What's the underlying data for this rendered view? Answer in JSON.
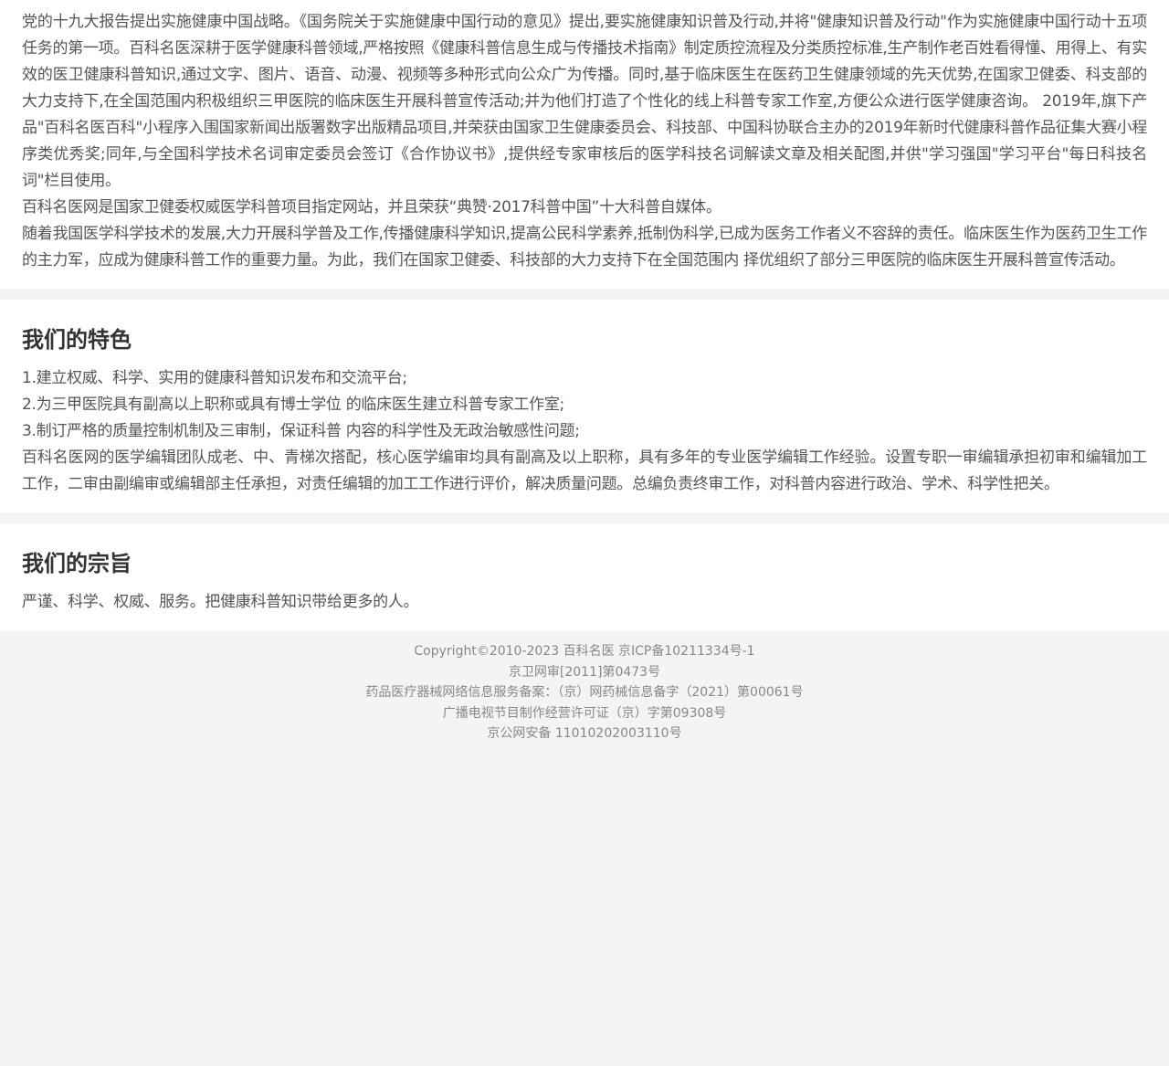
{
  "intro": {
    "paragraphs": [
      "党的十九大报告提出实施健康中国战略。《国务院关于实施健康中国行动的意见》提出,要实施健康知识普及行动,并将\"健康知识普及行动\"作为实施健康中国行动十五项任务的第一项。百科名医深耕于医学健康科普领域,严格按照《健康科普信息生成与传播技术指南》制定质控流程及分类质控标准,生产制作老百姓看得懂、用得上、有实效的医卫健康科普知识,通过文字、图片、语音、动漫、视频等多种形式向公众广为传播。同时,基于临床医生在医药卫生健康领域的先天优势,在国家卫健委、科支部的大力支持下,在全国范围内积极组织三甲医院的临床医生开展科普宣传活动;并为他们打造了个性化的线上科普专家工作室,方便公众进行医学健康咨询。 2019年,旗下产品\"百科名医百科\"小程序入围国家新闻出版署数字出版精品项目,并荣获由国家卫生健康委员会、科技部、中国科协联合主办的2019年新时代健康科普作品征集大赛小程序类优秀奖;同年,与全国科学技术名词审定委员会签订《合作协议书》,提供经专家审核后的医学科技名词解读文章及相关配图,并供\"学习强国\"学习平台\"每日科技名词\"栏目使用。",
      "百科名医网是国家卫健委权威医学科普项目指定网站，并且荣获“典赞·2017科普中国”十大科普自媒体。",
      "随着我国医学科学技术的发展,大力开展科学普及工作,传播健康科学知识,提高公民科学素养,抵制伪科学,已成为医务工作者义不容辞的责任。临床医生作为医药卫生工作的主力军，应成为健康科普工作的重要力量。为此，我们在国家卫健委、科技部的大力支持下在全国范围内 择优组织了部分三甲医院的临床医生开展科普宣传活动。"
    ]
  },
  "features": {
    "title": "我们的特色",
    "items": [
      "1.建立权威、科学、实用的健康科普知识发布和交流平台;",
      "2.为三甲医院具有副高以上职称或具有博士学位 的临床医生建立科普专家工作室;",
      "3.制订严格的质量控制机制及三审制，保证科普 内容的科学性及无政治敏感性问题;"
    ],
    "description": "百科名医网的医学编辑团队成老、中、青梯次搭配，核心医学编审均具有副高及以上职称，具有多年的专业医学编辑工作经验。设置专职一审编辑承担初审和编辑加工工作，二审由副编审或编辑部主任承担，对责任编辑的加工工作进行评价，解决质量问题。总编负责终审工作，对科普内容进行政治、学术、科学性把关。"
  },
  "purpose": {
    "title": "我们的宗旨",
    "text": "严谨、科学、权威、服务。把健康科普知识带给更多的人。"
  },
  "footer": {
    "copyright": "Copyright©2010-2023 百科名医 京ICP备10211334号-1",
    "health_review": "京卫网审[2011]第0473号",
    "drug_record": "药品医疗器械网络信息服务备案：（京）网药械信息备字（2021）第00061号",
    "broadcast_license": "广播电视节目制作经营许可证（京）字第09308号",
    "public_security": "京公网安备 11010202003110号"
  }
}
